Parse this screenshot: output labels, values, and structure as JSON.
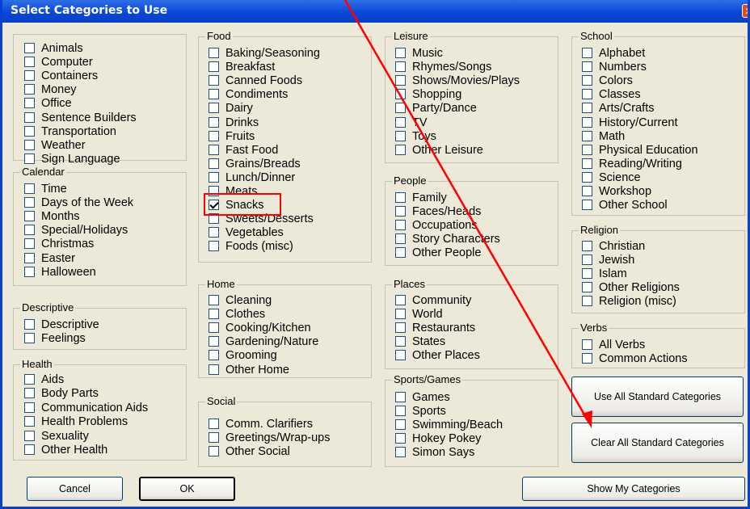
{
  "dialog": {
    "title": "Select Categories to Use",
    "close_label": "✕"
  },
  "groups": {
    "general": {
      "title": "",
      "items": [
        "Animals",
        "Computer",
        "Containers",
        "Money",
        "Office",
        "Sentence Builders",
        "Transportation",
        "Weather",
        "Sign Language"
      ]
    },
    "calendar": {
      "title": "Calendar",
      "items": [
        "Time",
        "Days of the Week",
        "Months",
        "Special/Holidays",
        "Christmas",
        "Easter",
        "Halloween"
      ]
    },
    "descriptive": {
      "title": "Descriptive",
      "items": [
        "Descriptive",
        "Feelings"
      ]
    },
    "health": {
      "title": "Health",
      "items": [
        "Aids",
        "Body Parts",
        "Communication Aids",
        "Health Problems",
        "Sexuality",
        "Other Health"
      ]
    },
    "food": {
      "title": "Food",
      "items": [
        "Baking/Seasoning",
        "Breakfast",
        "Canned Foods",
        "Condiments",
        "Dairy",
        "Drinks",
        "Fruits",
        "Fast Food",
        "Grains/Breads",
        "Lunch/Dinner",
        "Meats",
        "Snacks",
        "Sweets/Desserts",
        "Vegetables",
        "Foods (misc)"
      ]
    },
    "home": {
      "title": "Home",
      "items": [
        "Cleaning",
        "Clothes",
        "Cooking/Kitchen",
        "Gardening/Nature",
        "Grooming",
        "Other Home"
      ]
    },
    "social": {
      "title": "Social",
      "items": [
        "Comm. Clarifiers",
        "Greetings/Wrap-ups",
        "Other Social"
      ]
    },
    "leisure": {
      "title": "Leisure",
      "items": [
        "Music",
        "Rhymes/Songs",
        "Shows/Movies/Plays",
        "Shopping",
        "Party/Dance",
        "TV",
        "Toys",
        "Other Leisure"
      ]
    },
    "people": {
      "title": "People",
      "items": [
        "Family",
        "Faces/Heads",
        "Occupations",
        "Story Characters",
        "Other People"
      ]
    },
    "places": {
      "title": "Places",
      "items": [
        "Community",
        "World",
        "Restaurants",
        "States",
        "Other Places"
      ]
    },
    "sports": {
      "title": "Sports/Games",
      "items": [
        "Games",
        "Sports",
        "Swimming/Beach",
        "Hokey Pokey",
        "Simon Says"
      ]
    },
    "school": {
      "title": "School",
      "items": [
        "Alphabet",
        "Numbers",
        "Colors",
        "Classes",
        "Arts/Crafts",
        "History/Current",
        "Math",
        "Physical Education",
        "Reading/Writing",
        "Science",
        "Workshop",
        "Other School"
      ]
    },
    "religion": {
      "title": "Religion",
      "items": [
        "Christian",
        "Jewish",
        "Islam",
        "Other Religions",
        "Religion (misc)"
      ]
    },
    "verbs": {
      "title": "Verbs",
      "items": [
        "All Verbs",
        "Common Actions"
      ]
    }
  },
  "checked": [
    "Snacks"
  ],
  "buttons": {
    "use_all": "Use All Standard Categories",
    "clear_all": "Clear All Standard Categories",
    "show_my": "Show My Categories",
    "cancel": "Cancel",
    "ok": "OK"
  },
  "annotation": {
    "color": "#ff0000"
  }
}
